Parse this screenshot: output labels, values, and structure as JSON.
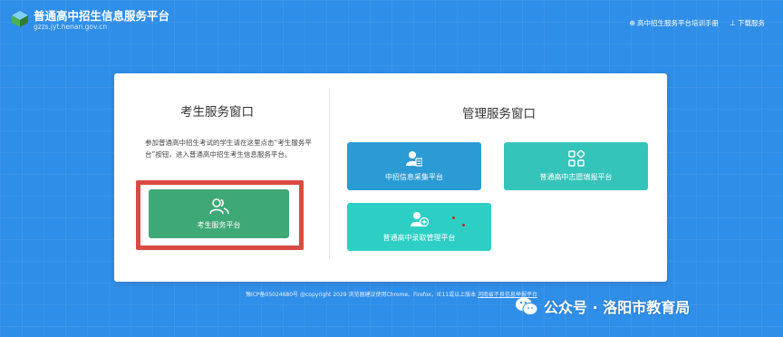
{
  "header": {
    "title": "普通高中招生信息服务平台",
    "url": "gzzs.jyt.henan.gov.cn",
    "links": [
      {
        "icon": "book-icon",
        "label": "高中招生服务平台培训手册"
      },
      {
        "icon": "download-icon",
        "label": "下载服务"
      }
    ]
  },
  "student_panel": {
    "title": "考生服务窗口",
    "description": "参加普通高中招生考试的学生请在这里点击“考生服务平台”按钮，进入普通高中招生考生信息服务平台。",
    "button": {
      "label": "考生服务平台",
      "icon": "users-icon"
    }
  },
  "admin_panel": {
    "title": "管理服务窗口",
    "buttons": [
      {
        "label": "中招信息采集平台",
        "icon": "user-id-icon"
      },
      {
        "label": "普通高中志愿填报平台",
        "icon": "grid-icon"
      },
      {
        "label": "普通高中录取管理平台",
        "icon": "user-add-icon"
      }
    ]
  },
  "footer": {
    "icp": "豫ICP备05024680号",
    "copyright": "@copyright 2029",
    "browser_note": "浏览器建议使用Chrome、Firefox，IE11或以上版本",
    "link": "河南省不良信息举报平台"
  },
  "watermark": {
    "text": "公众号 · 洛阳市教育局"
  },
  "colors": {
    "background": "#2f8ee8",
    "student_button": "#3ea977",
    "info_button": "#2a9bd5",
    "volunteer_button": "#35c4ba",
    "admission_button": "#2dcfc4",
    "highlight": "#d94b43"
  }
}
